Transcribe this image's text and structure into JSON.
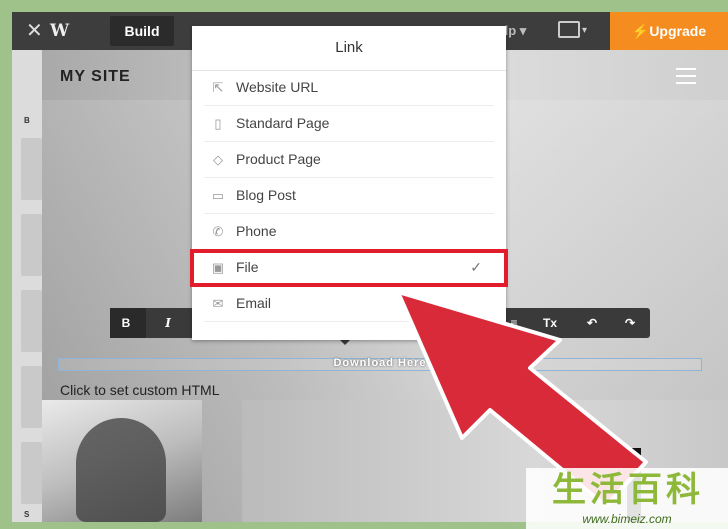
{
  "topbar": {
    "close_icon": "close-icon",
    "logo_icon": "weebly-logo-icon",
    "build_label": "Build",
    "help_label": "Help",
    "device_icon": "desktop-device-icon",
    "upgrade_label": "Upgrade",
    "upgrade_icon": "lightning-icon"
  },
  "site": {
    "title": "MY SITE",
    "menu_icon": "hamburger-icon",
    "download_text": "Download Here",
    "custom_html_text": "Click to set custom HTML"
  },
  "link_menu": {
    "title": "Link",
    "items": [
      {
        "label": "Website URL",
        "icon": "external-link-icon",
        "selected": false
      },
      {
        "label": "Standard Page",
        "icon": "page-icon",
        "selected": false
      },
      {
        "label": "Product Page",
        "icon": "tag-icon",
        "selected": false
      },
      {
        "label": "Blog Post",
        "icon": "comment-icon",
        "selected": false
      },
      {
        "label": "Phone",
        "icon": "phone-icon",
        "selected": false
      },
      {
        "label": "File",
        "icon": "folder-icon",
        "selected": true
      },
      {
        "label": "Email",
        "icon": "email-icon",
        "selected": false
      }
    ],
    "check_icon": "checkmark-icon"
  },
  "toolbar": {
    "bold": "B",
    "italic": "I",
    "clear_format": "Tx",
    "align_icon": "align-icon",
    "undo_icon": "undo-icon",
    "redo_icon": "redo-icon"
  },
  "colors": {
    "accent_orange": "#f58c1f",
    "highlight_red": "#e11c2b",
    "arrow_red": "#d92a3a"
  },
  "watermark": {
    "chars": "生活百科",
    "url": "www.bimeiz.com"
  }
}
